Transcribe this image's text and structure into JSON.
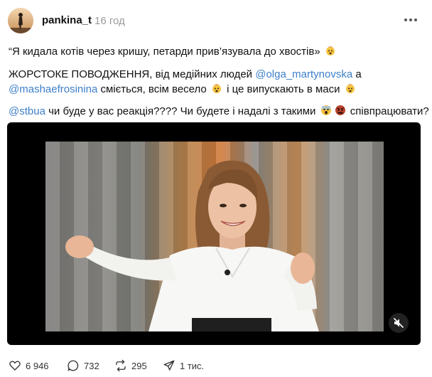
{
  "post": {
    "author": "pankina_t",
    "time": "16 год",
    "line1": {
      "text": "“Я кидала котів через кришу, петарди прив’язувала до хвостів»"
    },
    "line2": {
      "prefix": "ЖОРСТОКЕ ПОВОДЖЕННЯ, від медійних людей ",
      "mention1": "@olga_martynovska",
      "suffix": " а"
    },
    "line3": {
      "mention": "@mashaefrosinina",
      "middle": " сміється, всім весело ",
      "end": " і це випускають в маси "
    },
    "line4": {
      "mention": "@stbua",
      "text": " чи буде у вас реакція???? Чи будете і надалі з такими ",
      "end": " співпрацювати?"
    },
    "emoji": {
      "exploding_head": "exploding-head-emoji",
      "scream": "scream-emoji",
      "angry": "angry-face-emoji"
    }
  },
  "video": {
    "muted": true,
    "mute_icon": "speaker-muted-icon"
  },
  "actions": {
    "likes": "6 946",
    "comments": "732",
    "reposts": "295",
    "shares": "1 тис."
  },
  "colors": {
    "link": "#3d7fc8",
    "time": "#9a9a9a",
    "accent_orange": "#d07a3a"
  }
}
